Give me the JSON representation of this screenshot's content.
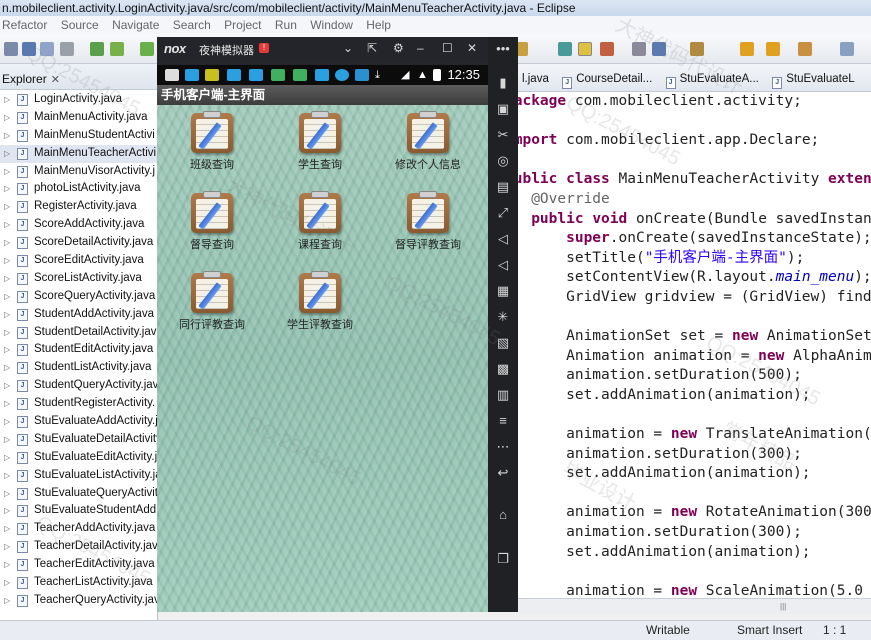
{
  "window": {
    "title": "n.mobileclient.activity.LoginActivity.java/src/com/mobileclient/activity/MainMenuTeacherActivity.java - Eclipse"
  },
  "menu": [
    "Refactor",
    "Source",
    "Navigate",
    "Search",
    "Project",
    "Run",
    "Window",
    "Help"
  ],
  "explorer": {
    "title": "Explorer",
    "files": [
      "LoginActivity.java",
      "MainMenuActivity.java",
      "MainMenuStudentActivi",
      "MainMenuTeacherActivi",
      "MainMenuVisorActivity.j",
      "photoListActivity.java",
      "RegisterActivity.java",
      "ScoreAddActivity.java",
      "ScoreDetailActivity.java",
      "ScoreEditActivity.java",
      "ScoreListActivity.java",
      "ScoreQueryActivity.java",
      "StudentAddActivity.java",
      "StudentDetailActivity.jav",
      "StudentEditActivity.java",
      "StudentListActivity.java",
      "StudentQueryActivity.jav",
      "StudentRegisterActivity.",
      "StuEvaluateAddActivity.j",
      "StuEvaluateDetailActivity",
      "StuEvaluateEditActivity.ja",
      "StuEvaluateListActivity.ja",
      "StuEvaluateQueryActivit",
      "StuEvaluateStudentAdd",
      "TeacherAddActivity.java",
      "TeacherDetailActivity.jav",
      "TeacherEditActivity.java",
      "TeacherListActivity.java",
      "TeacherQueryActivity.jav"
    ]
  },
  "editor": {
    "tabs": [
      "l.java",
      "CourseDetail...",
      "StuEvaluateA...",
      "StuEvaluateL"
    ]
  },
  "status": {
    "mode": "Writable",
    "insert": "Smart Insert",
    "position": "1 : 1"
  },
  "emulator": {
    "logo": "nox",
    "title": "夜神模拟器",
    "badge": "!",
    "clock": "12:35",
    "app_title": "手机客户端-主界面",
    "grid": [
      "班级查询",
      "学生查询",
      "修改个人信息",
      "督导查询",
      "课程查询",
      "督导评教查询",
      "同行评教查询",
      "学生评教查询"
    ]
  },
  "watermark": [
    "QQ:25454045",
    "大神代码代设计",
    "毕业设计",
    "常年精品"
  ]
}
